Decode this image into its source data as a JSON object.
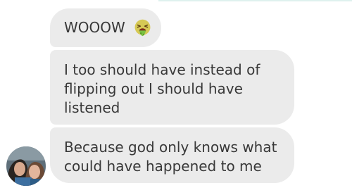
{
  "messages": [
    {
      "text": "WOOOW",
      "emoji": "vomiting-face-icon"
    },
    {
      "lines": [
        "I too should have instead of",
        "flipping out I should have",
        "listened"
      ]
    },
    {
      "lines": [
        "Because god only knows what",
        "could have happened to me"
      ]
    }
  ],
  "sender": {
    "avatar": "profile-photo"
  },
  "colors": {
    "bubble": "#ebebeb",
    "text": "#383838",
    "background": "#ffffff",
    "accent_line": "#dff1ee"
  }
}
